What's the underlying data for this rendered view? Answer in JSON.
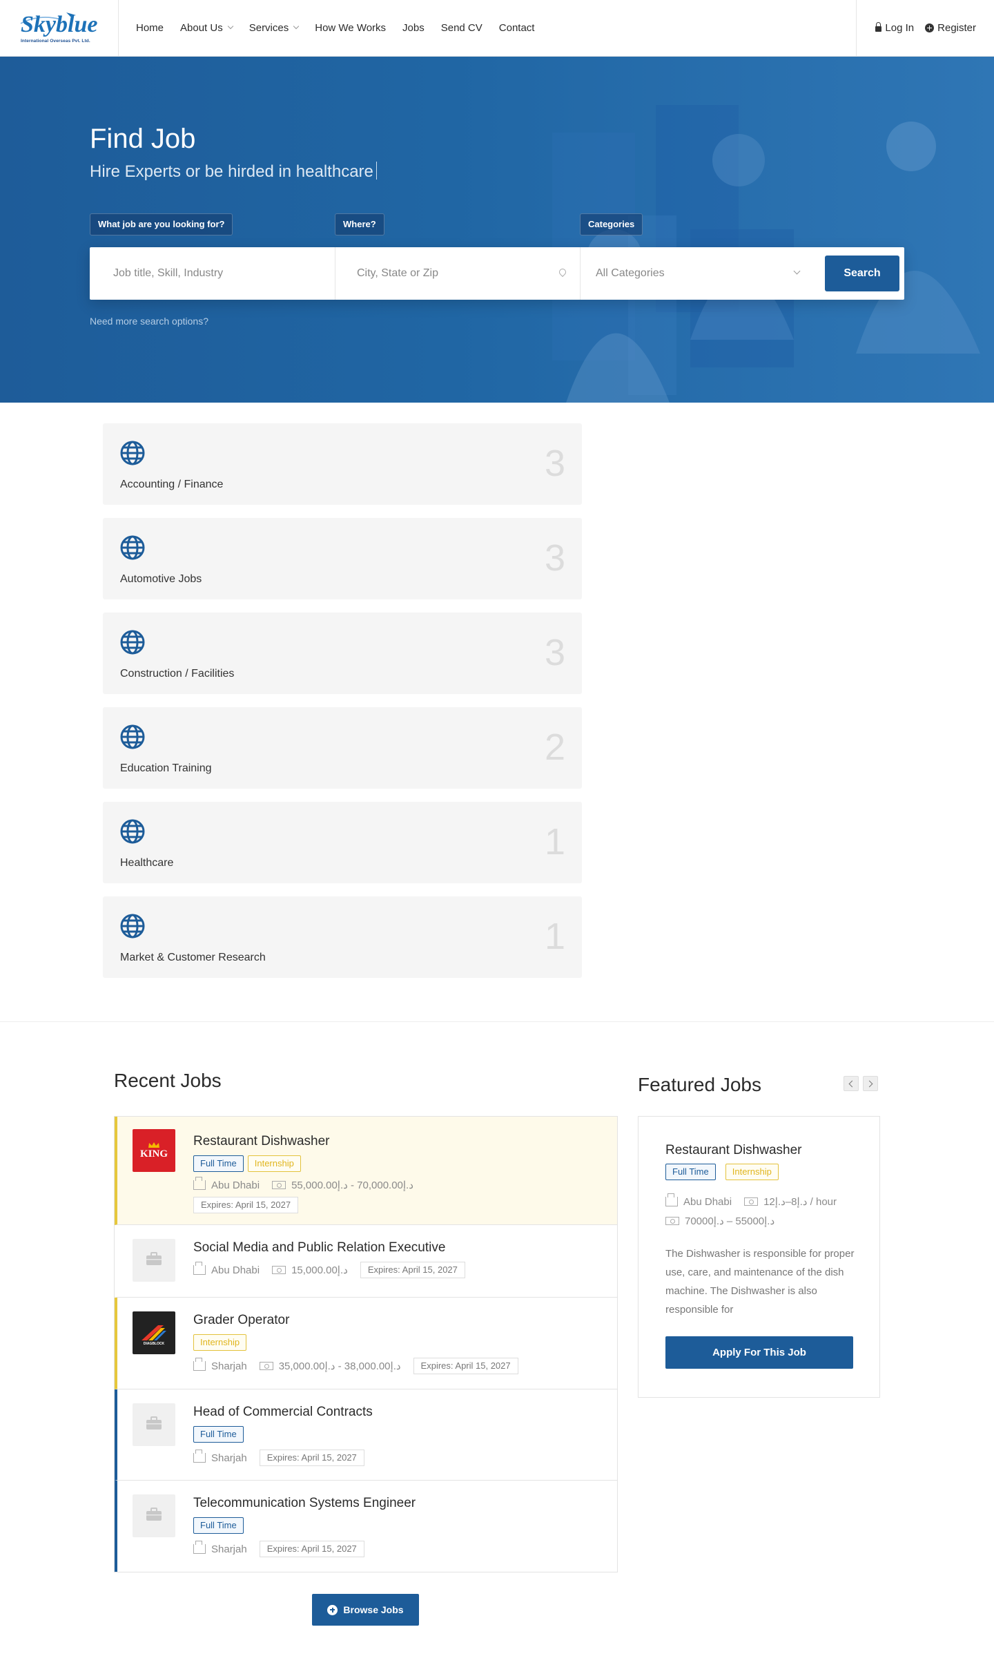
{
  "header": {
    "logo_text": "Skyblue",
    "logo_subtitle": "International Overseas Pvt. Ltd.",
    "nav": [
      {
        "label": "Home",
        "dropdown": false
      },
      {
        "label": "About Us",
        "dropdown": true
      },
      {
        "label": "Services",
        "dropdown": true
      },
      {
        "label": "How We Works",
        "dropdown": false
      },
      {
        "label": "Jobs",
        "dropdown": false
      },
      {
        "label": "Send CV",
        "dropdown": false
      },
      {
        "label": "Contact",
        "dropdown": false
      }
    ],
    "login_label": "Log In",
    "register_label": "Register"
  },
  "hero": {
    "title": "Find Job",
    "subtitle": "Hire Experts or be hirded in healthcare",
    "what_label": "What job are you looking for?",
    "where_label": "Where?",
    "categories_label": "Categories",
    "keyword_placeholder": "Job title, Skill, Industry",
    "location_placeholder": "City, State or Zip",
    "category_selected": "All Categories",
    "search_button": "Search",
    "more_options": "Need more search options?"
  },
  "categories": [
    {
      "name": "Accounting / Finance",
      "count": "3"
    },
    {
      "name": "Automotive Jobs",
      "count": "3"
    },
    {
      "name": "Construction / Facilities",
      "count": "3"
    },
    {
      "name": "Education Training",
      "count": "2"
    },
    {
      "name": "Healthcare",
      "count": "1"
    },
    {
      "name": "Market & Customer Research",
      "count": "1"
    }
  ],
  "recent_jobs": {
    "title": "Recent Jobs",
    "jobs": [
      {
        "title": "Restaurant Dishwasher",
        "tags": [
          "Full Time",
          "Internship"
        ],
        "location": "Abu Dhabi",
        "salary": "د.إ70,000.00 - د.إ55,000.00",
        "expires": "Expires: April 15, 2027",
        "logo": "KING"
      },
      {
        "title": "Social Media and Public Relation Executive",
        "tags": [],
        "location": "Abu Dhabi",
        "salary": "د.إ15,000.00",
        "expires": "Expires: April 15, 2027",
        "logo": ""
      },
      {
        "title": "Grader Operator",
        "tags": [
          "Internship"
        ],
        "location": "Sharjah",
        "salary": "د.إ38,000.00 - د.إ35,000.00",
        "expires": "Expires: April 15, 2027",
        "logo": "DIAGBLOCK"
      },
      {
        "title": "Head of Commercial Contracts",
        "tags": [
          "Full Time"
        ],
        "location": "Sharjah",
        "salary": "",
        "expires": "Expires: April 15, 2027",
        "logo": ""
      },
      {
        "title": "Telecommunication Systems Engineer",
        "tags": [
          "Full Time"
        ],
        "location": "Sharjah",
        "salary": "",
        "expires": "Expires: April 15, 2027",
        "logo": ""
      }
    ],
    "browse_button": "Browse Jobs"
  },
  "featured_jobs": {
    "title": "Featured Jobs",
    "job": {
      "title": "Restaurant Dishwasher",
      "tags": [
        "Full Time",
        "Internship"
      ],
      "location": "Abu Dhabi",
      "rate": "د.إ8–د.إ12 / hour",
      "salary": "د.إ55000 – د.إ70000",
      "description": "The Dishwasher is responsible for proper use, care, and maintenance of the dish machine. The Dishwasher is also responsible for",
      "apply_button": "Apply For This Job"
    }
  },
  "colors": {
    "primary": "#1d5c99",
    "featured_bg": "#fefaea",
    "featured_accent": "#e6c73b",
    "king_red": "#d92027"
  }
}
